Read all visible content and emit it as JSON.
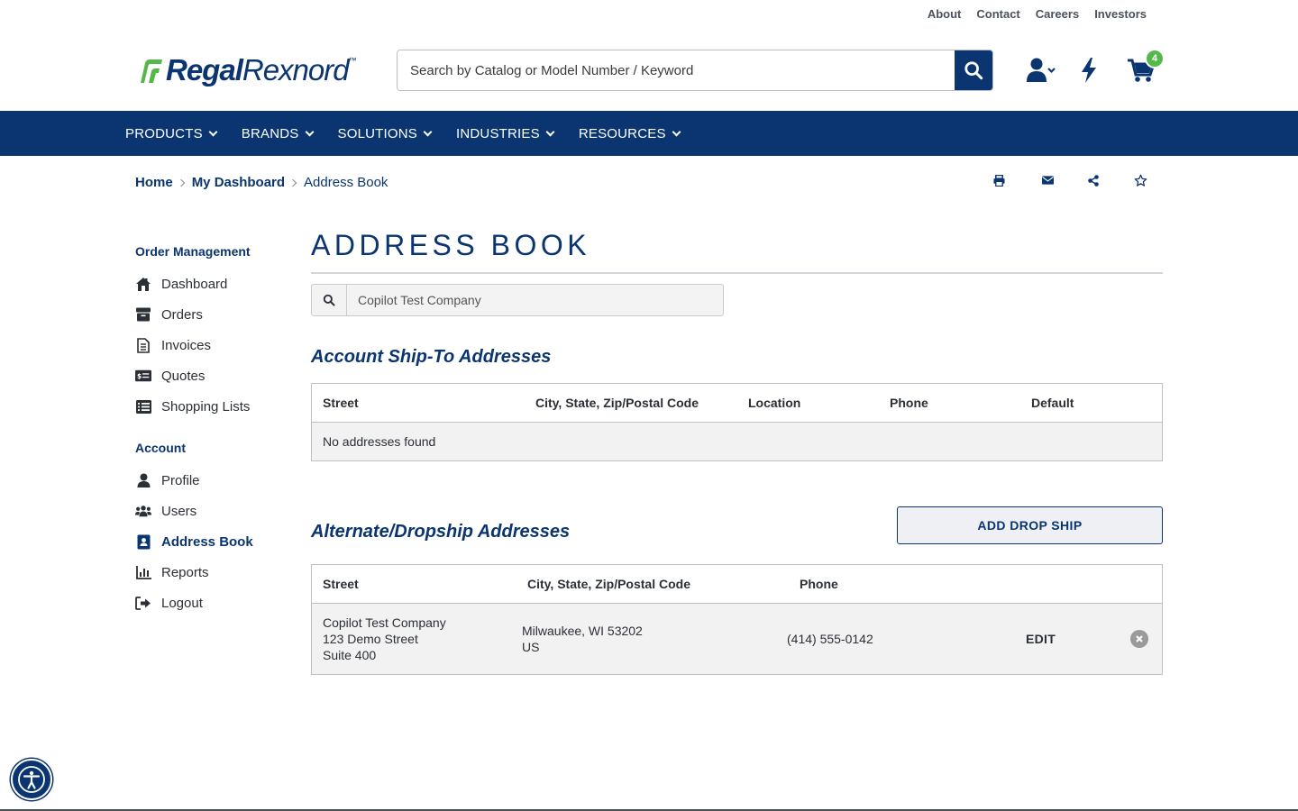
{
  "utility_nav": [
    "About",
    "Contact",
    "Careers",
    "Investors"
  ],
  "logo": {
    "bold": "Regal",
    "light": "Rexnord",
    "tm": "™"
  },
  "search": {
    "placeholder": "Search by Catalog or Model Number / Keyword"
  },
  "cart": {
    "count": "4"
  },
  "main_nav": [
    "PRODUCTS",
    "BRANDS",
    "SOLUTIONS",
    "INDUSTRIES",
    "RESOURCES"
  ],
  "breadcrumb": [
    "Home",
    "My Dashboard",
    "Address Book"
  ],
  "sidebar": {
    "order_heading": "Order Management",
    "order_items": [
      "Dashboard",
      "Orders",
      "Invoices",
      "Quotes",
      "Shopping Lists"
    ],
    "account_heading": "Account",
    "account_items": [
      "Profile",
      "Users",
      "Address Book",
      "Reports",
      "Logout"
    ]
  },
  "page": {
    "title": "ADDRESS BOOK",
    "filter_value": "Copilot Test Company"
  },
  "ship_to": {
    "title": "Account Ship-To Addresses",
    "headers": [
      "Street",
      "City, State, Zip/Postal Code",
      "Location",
      "Phone",
      "Default"
    ],
    "empty": "No addresses found"
  },
  "dropship": {
    "title": "Alternate/Dropship Addresses",
    "add_label": "ADD DROP SHIP",
    "headers": [
      "Street",
      "City, State, Zip/Postal Code",
      "Phone"
    ],
    "rows": [
      {
        "street": [
          "Copilot Test Company",
          "123 Demo Street",
          "Suite 400"
        ],
        "city": [
          "Milwaukee, WI 53202",
          "US"
        ],
        "phone": "(414) 555-0142",
        "edit": "EDIT"
      }
    ]
  },
  "colors": {
    "brand": "#0b3570",
    "accent_green": "#55b94a"
  }
}
